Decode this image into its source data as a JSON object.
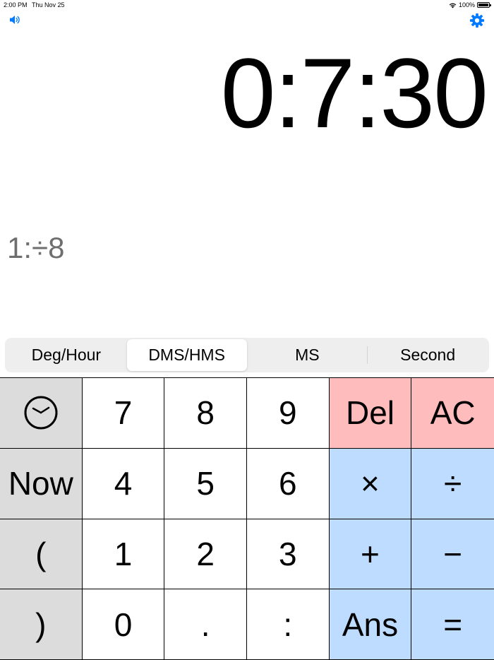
{
  "status_bar": {
    "time": "2:00 PM",
    "date": "Thu Nov 25",
    "battery": "100%"
  },
  "toolbar": {
    "sound_icon": "speaker-icon",
    "settings_icon": "gear-icon",
    "accent_color": "#007aff"
  },
  "display": {
    "result": "0:7:30",
    "expression": "1:÷8"
  },
  "modes": {
    "items": [
      "Deg/Hour",
      "DMS/HMS",
      "MS",
      "Second"
    ],
    "selected": "DMS/HMS"
  },
  "keypad": {
    "clock_icon": "clock-icon",
    "now": "Now",
    "paren_open": "(",
    "paren_close": ")",
    "seven": "7",
    "eight": "8",
    "nine": "9",
    "four": "4",
    "five": "5",
    "six": "6",
    "one": "1",
    "two": "2",
    "three": "3",
    "zero": "0",
    "dot": ".",
    "colon": ":",
    "del": "Del",
    "ac": "AC",
    "multiply": "×",
    "divide": "÷",
    "plus": "+",
    "minus": "−",
    "ans": "Ans",
    "equals": "="
  },
  "colors": {
    "func_key": "#dcdcdc",
    "clear_key": "#ffbcbc",
    "operator_key": "#bddcff"
  }
}
